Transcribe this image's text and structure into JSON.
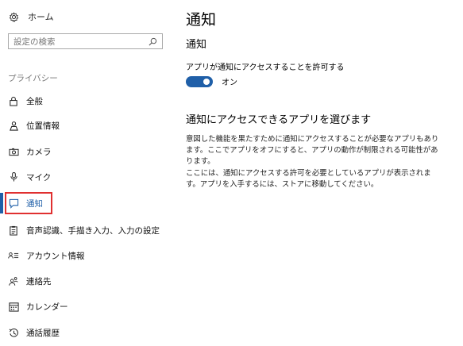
{
  "sidebar": {
    "home_label": "ホーム",
    "search_placeholder": "設定の検索",
    "section_label": "プライバシー",
    "items": [
      {
        "label": "全般",
        "icon": "lock-icon"
      },
      {
        "label": "位置情報",
        "icon": "location-person-icon"
      },
      {
        "label": "カメラ",
        "icon": "camera-icon"
      },
      {
        "label": "マイク",
        "icon": "microphone-icon"
      },
      {
        "label": "通知",
        "icon": "notification-icon",
        "active": true
      },
      {
        "label": "音声認識、手描き入力、入力の設定",
        "icon": "clipboard-icon"
      },
      {
        "label": "アカウント情報",
        "icon": "account-info-icon"
      },
      {
        "label": "連絡先",
        "icon": "contacts-icon"
      },
      {
        "label": "カレンダー",
        "icon": "calendar-icon"
      },
      {
        "label": "通話履歴",
        "icon": "history-icon"
      }
    ]
  },
  "main": {
    "page_title": "通知",
    "subtitle": "通知",
    "toggle_label": "アプリが通知にアクセスすることを許可する",
    "toggle_state": "オン",
    "toggle_on": true,
    "section_title": "通知にアクセスできるアプリを選びます",
    "para1": "意図した機能を果たすために通知にアクセスすることが必要なアプリもあります。ここでアプリをオフにすると、アプリの動作が制限される可能性があります。",
    "para2": "ここには、通知にアクセスする許可を必要としているアプリが表示されます。アプリを入手するには、ストアに移動してください。"
  },
  "colors": {
    "accent": "#1f5fa8",
    "highlight_border": "#e03030"
  }
}
